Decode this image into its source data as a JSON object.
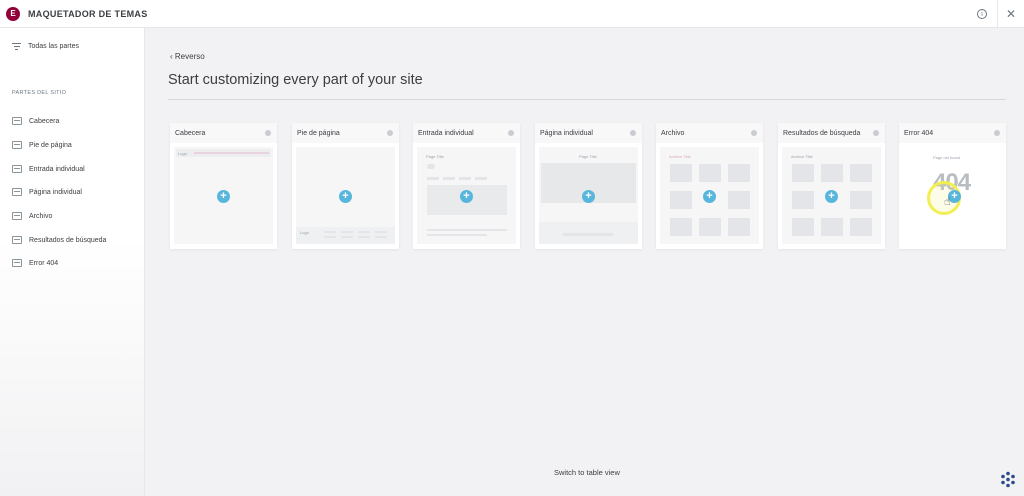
{
  "app": {
    "title": "MAQUETADOR DE TEMAS",
    "logo_letter": "E"
  },
  "sidebar": {
    "all_parts": "Todas las partes",
    "section_label": "PARTES DEL SITIO",
    "items": [
      {
        "label": "Cabecera",
        "icon": "header-icon"
      },
      {
        "label": "Pie de página",
        "icon": "footer-icon"
      },
      {
        "label": "Entrada individual",
        "icon": "single-post-icon"
      },
      {
        "label": "Página individual",
        "icon": "single-page-icon"
      },
      {
        "label": "Archivo",
        "icon": "archive-icon"
      },
      {
        "label": "Resultados de búsqueda",
        "icon": "search-results-icon"
      },
      {
        "label": "Error 404",
        "icon": "error-404-icon"
      }
    ]
  },
  "main": {
    "back_label": "Reverso",
    "headline": "Start customizing every part of your site",
    "cards": [
      {
        "title": "Cabecera",
        "preview_text": "Logo"
      },
      {
        "title": "Pie de página",
        "preview_text": "Logo"
      },
      {
        "title": "Entrada individual",
        "preview_text": "Page Title"
      },
      {
        "title": "Página individual",
        "preview_text": "Page Title"
      },
      {
        "title": "Archivo",
        "preview_text": "Archive Title"
      },
      {
        "title": "Resultados de búsqueda",
        "preview_text": "Archive Title"
      },
      {
        "title": "Error 404",
        "preview_text": "Page not found",
        "big_text": "404"
      }
    ],
    "switch_view": "Switch to table view"
  },
  "colors": {
    "brand": "#92003b",
    "accent": "#58b6dc",
    "cursor_highlight": "#f3ee52"
  }
}
